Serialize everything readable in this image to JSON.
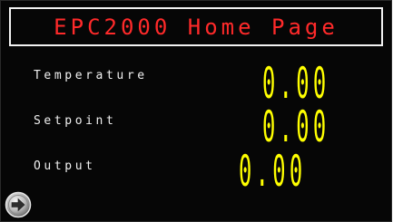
{
  "header": {
    "title": "EPC2000 Home Page"
  },
  "readings": [
    {
      "label": "Temperature",
      "value": "0.00"
    },
    {
      "label": "Setpoint",
      "value": "0.00"
    },
    {
      "label": "Output",
      "value": "0.00"
    }
  ],
  "nav": {
    "icon": "next-arrow-icon"
  },
  "colors": {
    "background": "#060606",
    "title": "#ff2a2a",
    "label": "#f0f0f0",
    "value": "#ffff00",
    "frame_border": "#f2f2f2"
  }
}
